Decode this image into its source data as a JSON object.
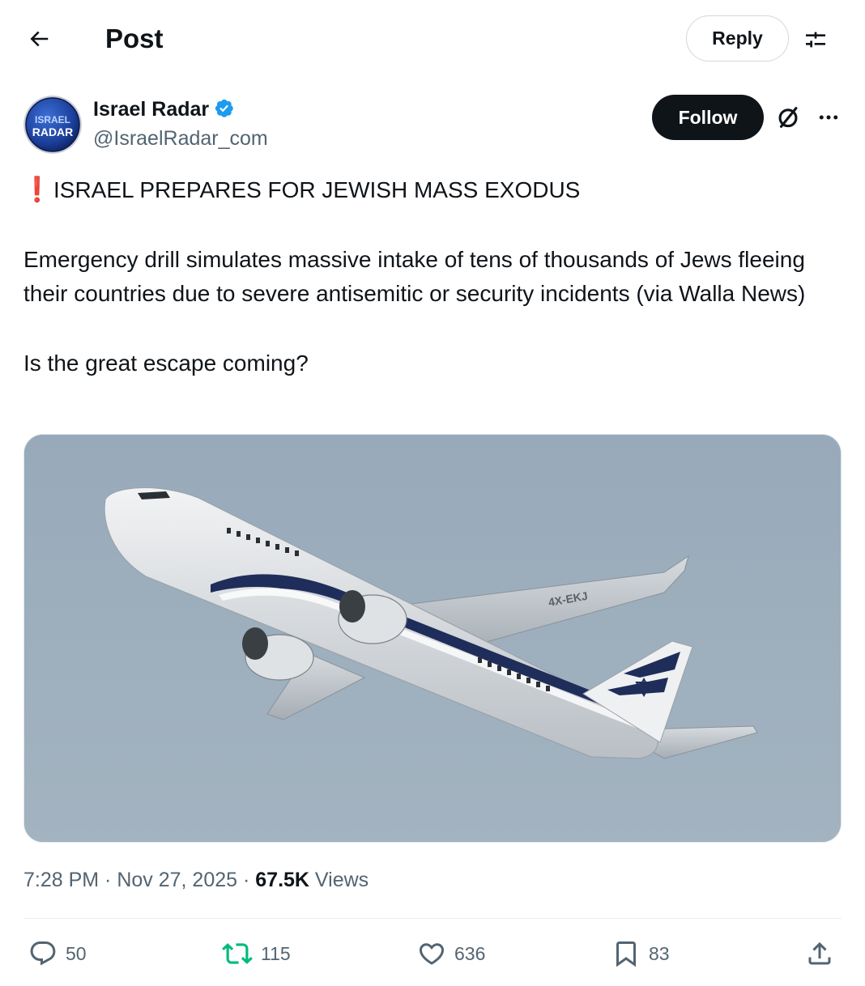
{
  "header": {
    "title": "Post",
    "reply_label": "Reply"
  },
  "author": {
    "avatar_text_top": "ISRAEL",
    "avatar_text_bottom": "RADAR",
    "name": "Israel Radar",
    "handle": "@IsraelRadar_com",
    "follow_label": "Follow"
  },
  "post": {
    "headline": "ISRAEL PREPARES FOR JEWISH MASS EXODUS",
    "headline_emoji": "❗",
    "paragraph": "Emergency drill simulates massive intake of tens of thousands of Jews fleeing their countries due to severe antisemitic or security incidents (via Walla News)",
    "question": "Is the great escape coming?",
    "media": {
      "description": "",
      "tail_reg": "4X-EKJ"
    }
  },
  "meta": {
    "time": "7:28 PM",
    "separator": " · ",
    "date": "Nov 27, 2025",
    "views_count": "67.5K",
    "views_label": " Views"
  },
  "actions": {
    "replies": "50",
    "reposts": "115",
    "likes": "636",
    "bookmarks": "83"
  },
  "colors": {
    "text_primary": "#0f1419",
    "text_secondary": "#536471",
    "verified_blue": "#1d9bf0",
    "follow_bg": "#0f1419",
    "retweet_green": "#00ba7c",
    "alert_red": "#dd2e44"
  },
  "icons": {
    "back": "arrow-left-icon",
    "settings": "sliders-icon",
    "verified": "verified-badge-icon",
    "grok": "grok-icon",
    "more": "more-dots-icon",
    "reply": "reply-bubble-icon",
    "repost": "repost-icon",
    "like": "heart-icon",
    "bookmark": "bookmark-icon",
    "share": "share-icon"
  }
}
